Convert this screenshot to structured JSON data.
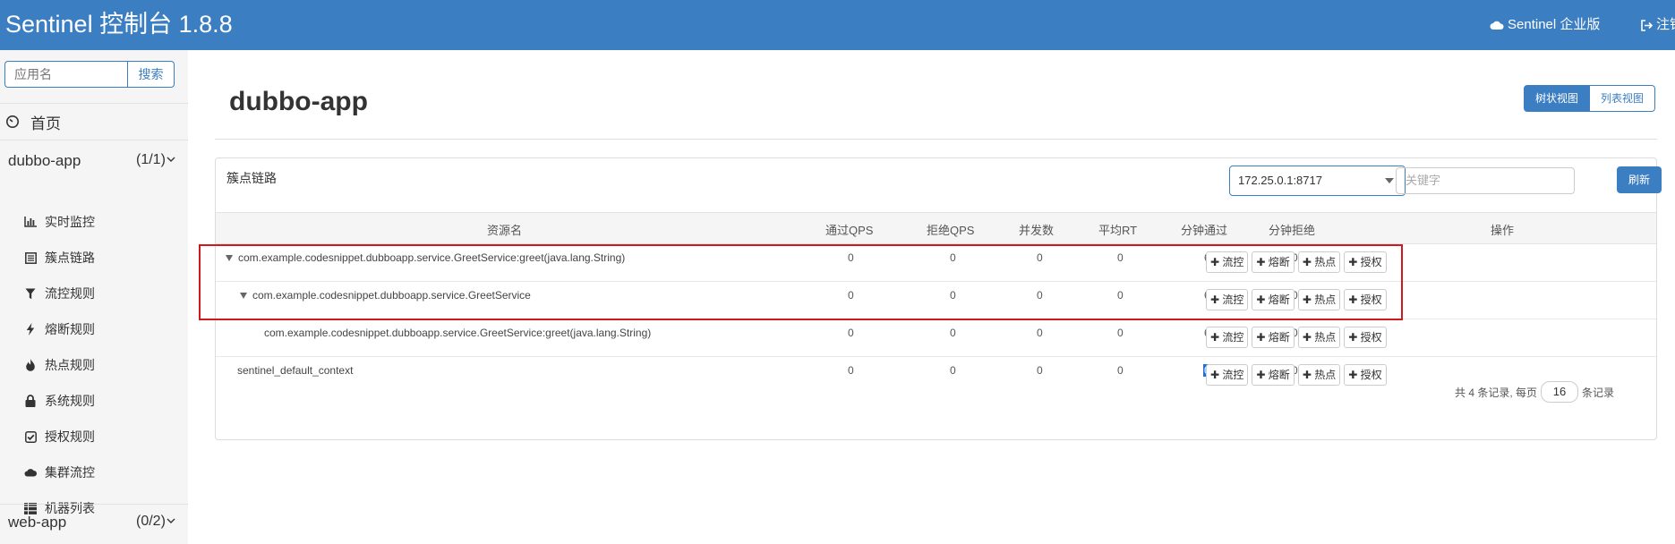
{
  "header": {
    "title": "Sentinel 控制台 1.8.8",
    "enterprise_label": "Sentinel 企业版",
    "logout_label": "注销"
  },
  "sidebar": {
    "search_placeholder": "应用名",
    "search_button": "搜索",
    "home_label": "首页",
    "apps": [
      {
        "name": "dubbo-app",
        "count": "(1/1)"
      },
      {
        "name": "web-app",
        "count": "(0/2)"
      }
    ],
    "menu": [
      {
        "label": "实时监控",
        "icon": "bar-chart-icon"
      },
      {
        "label": "簇点链路",
        "icon": "list-icon"
      },
      {
        "label": "流控规则",
        "icon": "filter-icon"
      },
      {
        "label": "熔断规则",
        "icon": "flash-icon"
      },
      {
        "label": "热点规则",
        "icon": "fire-icon"
      },
      {
        "label": "系统规则",
        "icon": "lock-icon"
      },
      {
        "label": "授权规则",
        "icon": "check-square-icon"
      },
      {
        "label": "集群流控",
        "icon": "cloud-icon"
      },
      {
        "label": "机器列表",
        "icon": "grid-list-icon"
      }
    ]
  },
  "main": {
    "title": "dubbo-app",
    "view_tree": "树状视图",
    "view_list": "列表视图",
    "panel_title": "簇点链路",
    "machine": "172.25.0.1:8717",
    "keyword_placeholder": "关键字",
    "refresh": "刷新",
    "columns": [
      "资源名",
      "通过QPS",
      "拒绝QPS",
      "并发数",
      "平均RT",
      "分钟通过",
      "分钟拒绝",
      "操作"
    ],
    "rows": [
      {
        "resource": "com.example.codesnippet.dubboapp.service.GreetService:greet(java.lang.String)",
        "pass_qps": "0",
        "block_qps": "0",
        "threads": "0",
        "avg_rt": "0",
        "min_pass": "6",
        "min_block": "0"
      },
      {
        "resource": "com.example.codesnippet.dubboapp.service.GreetService",
        "pass_qps": "0",
        "block_qps": "0",
        "threads": "0",
        "avg_rt": "0",
        "min_pass": "6",
        "min_block": "0"
      },
      {
        "resource": "com.example.codesnippet.dubboapp.service.GreetService:greet(java.lang.String)",
        "pass_qps": "0",
        "block_qps": "0",
        "threads": "0",
        "avg_rt": "0",
        "min_pass": "6",
        "min_block": "0"
      },
      {
        "resource": "sentinel_default_context",
        "pass_qps": "0",
        "block_qps": "0",
        "threads": "0",
        "avg_rt": "0",
        "min_pass": "0",
        "min_block": "0"
      }
    ],
    "ops": [
      "流控",
      "熔断",
      "热点",
      "授权"
    ],
    "pager_prefix": "共 4 条记录, 每页",
    "page_size": "16",
    "pager_suffix": "条记录"
  },
  "colors": {
    "brand": "#3c7ec2",
    "highlight": "#d0191f"
  }
}
